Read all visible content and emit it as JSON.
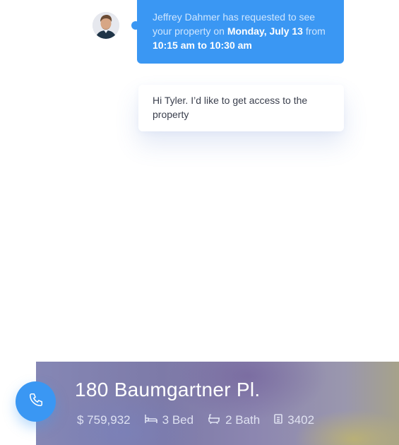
{
  "chat": {
    "request": {
      "part1": "Jeffrey Dahmer has requested to see your property on ",
      "date": "Monday, July 13",
      "from_word": " from ",
      "time": "10:15 am to 10:30 am"
    },
    "reply": {
      "text": "Hi Tyler. I’d like to get access to the property"
    }
  },
  "property": {
    "title": "180 Baumgartner Pl.",
    "price": "$ 759,932",
    "beds": "3 Bed",
    "baths": "2 Bath",
    "sqft": "3402"
  },
  "icons": {
    "avatar": "user-avatar",
    "call": "phone-icon",
    "bed": "bed-icon",
    "bath": "bathtub-icon",
    "area": "document-icon"
  },
  "colors": {
    "accent": "#3a97f3"
  }
}
